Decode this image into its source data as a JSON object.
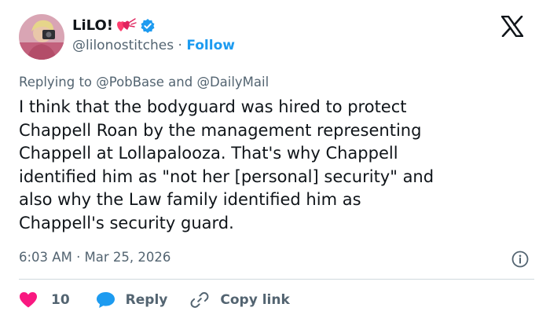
{
  "author": {
    "display_name": "LiLO!",
    "handle": "@lilonostitches",
    "separator": "·",
    "follow_label": "Follow"
  },
  "reply_context": {
    "prefix": "Replying to",
    "mention_1": "@PobBase",
    "conjunction": "and",
    "mention_2": "@DailyMail"
  },
  "tweet": {
    "lines": [
      "I think that the bodyguard was hired to protect",
      "Chappell Roan by the management representing",
      "Chappell at Lollapalooza. That's why Chappell",
      "identified him as \"not her [personal] security\" and",
      "also why the Law family identified him as",
      "Chappell's security guard."
    ],
    "timestamp": "6:03 AM · Mar 25, 2026"
  },
  "actions": {
    "like_count": "10",
    "reply_label": "Reply",
    "copy_link_label": "Copy link"
  },
  "colors": {
    "accent_blue": "#1d9bf0",
    "like_red": "#f91880",
    "text_primary": "#0f1419",
    "text_secondary": "#536471",
    "divider": "#cfd9de"
  },
  "icons": [
    "x-logo-icon",
    "verified-badge-icon",
    "heart-emoji-icon",
    "info-icon",
    "heart-icon",
    "reply-bubble-icon",
    "link-icon"
  ]
}
